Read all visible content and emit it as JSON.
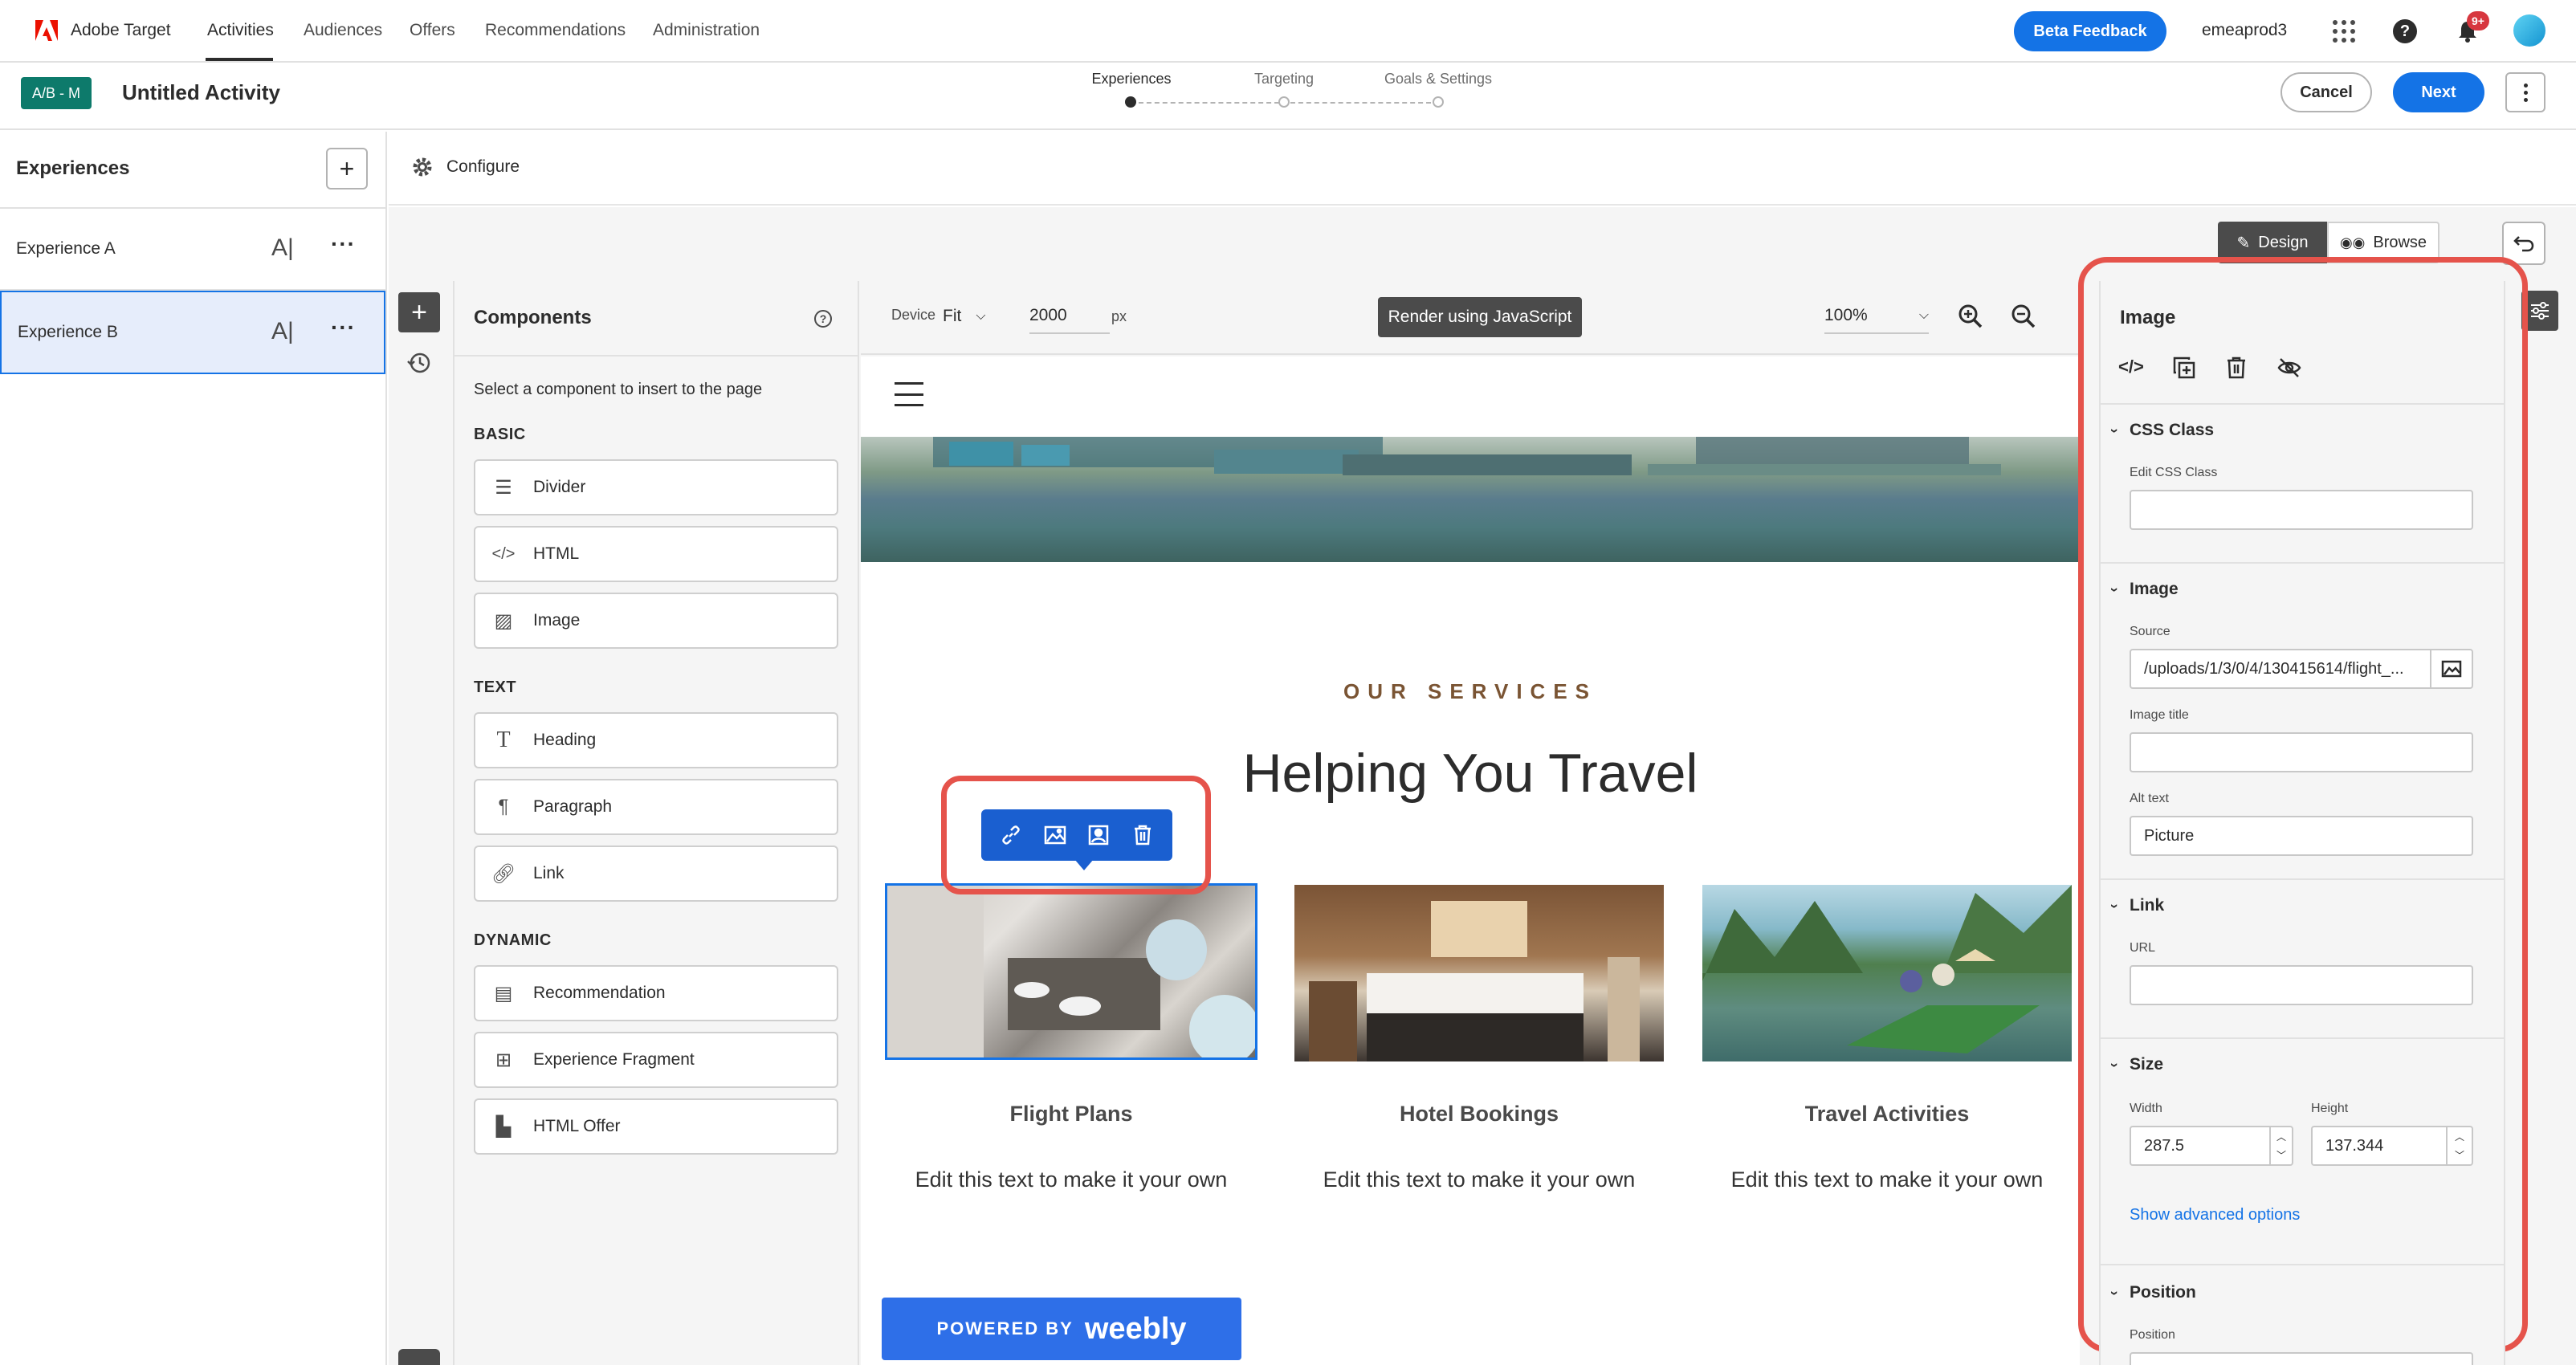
{
  "topnav": {
    "brand": "Adobe Target",
    "links": [
      "Activities",
      "Audiences",
      "Offers",
      "Recommendations",
      "Administration"
    ],
    "active_link": "Activities",
    "beta_feedback": "Beta Feedback",
    "org": "emeaprod3",
    "notification_badge": "9+"
  },
  "activity": {
    "type_badge": "A/B - M",
    "name": "Untitled Activity",
    "steps": [
      "Experiences",
      "Targeting",
      "Goals & Settings"
    ],
    "cancel": "Cancel",
    "next": "Next"
  },
  "sidebar": {
    "title": "Experiences",
    "experiences": [
      {
        "name": "Experience A",
        "icon_text": "A|"
      },
      {
        "name": "Experience B",
        "icon_text": "A|"
      }
    ]
  },
  "configure": {
    "label": "Configure"
  },
  "modes": {
    "design": "Design",
    "browse": "Browse"
  },
  "components": {
    "title": "Components",
    "instruction": "Select a component to insert to the page",
    "basic_label": "BASIC",
    "basic": [
      "Divider",
      "HTML",
      "Image"
    ],
    "text_label": "TEXT",
    "text": [
      "Heading",
      "Paragraph",
      "Link"
    ],
    "dynamic_label": "DYNAMIC",
    "dynamic": [
      "Recommendation",
      "Experience Fragment",
      "HTML Offer"
    ]
  },
  "canvas_toolbar": {
    "device_label": "Device",
    "device_value": "Fit",
    "width_value": "2000",
    "unit": "px",
    "render_button": "Render using JavaScript",
    "zoom": "100%"
  },
  "page_preview": {
    "services_label": "OUR SERVICES",
    "heading": "Helping You Travel",
    "cards": [
      {
        "title": "Flight Plans",
        "text": "Edit this text to make it your own"
      },
      {
        "title": "Hotel Bookings",
        "text": "Edit this text to make it your own"
      },
      {
        "title": "Travel Activities",
        "text": "Edit this text to make it your own"
      }
    ],
    "powered_prefix": "POWERED BY",
    "powered_brand": "weebly"
  },
  "properties": {
    "title": "Image",
    "css_section": "CSS Class",
    "css_label": "Edit CSS Class",
    "css_value": "",
    "image_section": "Image",
    "source_label": "Source",
    "source_value": "/uploads/1/3/0/4/130415614/flight_...",
    "title_label": "Image title",
    "title_value": "",
    "alt_label": "Alt text",
    "alt_value": "Picture",
    "link_section": "Link",
    "url_label": "URL",
    "url_value": "",
    "size_section": "Size",
    "width_label": "Width",
    "width_value": "287.5",
    "height_label": "Height",
    "height_value": "137.344",
    "advanced_link": "Show advanced options",
    "position_section": "Position",
    "position_label": "Position"
  },
  "colors": {
    "accent": "#1473e6",
    "highlight": "#e5534b",
    "badge_green": "#0d7a6b",
    "selected_bg": "#e6edfb"
  }
}
